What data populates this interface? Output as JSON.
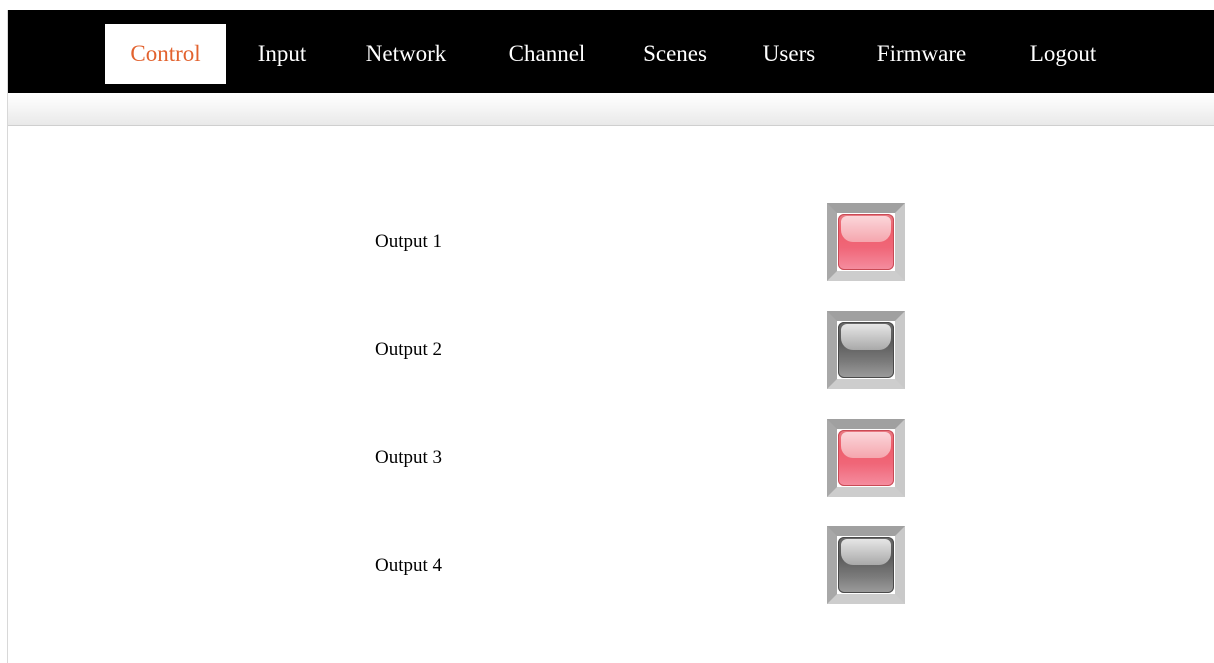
{
  "nav": {
    "items": [
      {
        "label": "Control",
        "active": true
      },
      {
        "label": "Input",
        "active": false
      },
      {
        "label": "Network",
        "active": false
      },
      {
        "label": "Channel",
        "active": false
      },
      {
        "label": "Scenes",
        "active": false
      },
      {
        "label": "Users",
        "active": false
      },
      {
        "label": "Firmware",
        "active": false
      },
      {
        "label": "Logout",
        "active": false
      }
    ]
  },
  "colors": {
    "active_tab_text": "#e2622e",
    "led_on": "#f06678",
    "led_off": "#6a6a6a"
  },
  "outputs": [
    {
      "label": "Output 1",
      "state": "on"
    },
    {
      "label": "Output 2",
      "state": "off"
    },
    {
      "label": "Output 3",
      "state": "on"
    },
    {
      "label": "Output 4",
      "state": "off"
    }
  ]
}
